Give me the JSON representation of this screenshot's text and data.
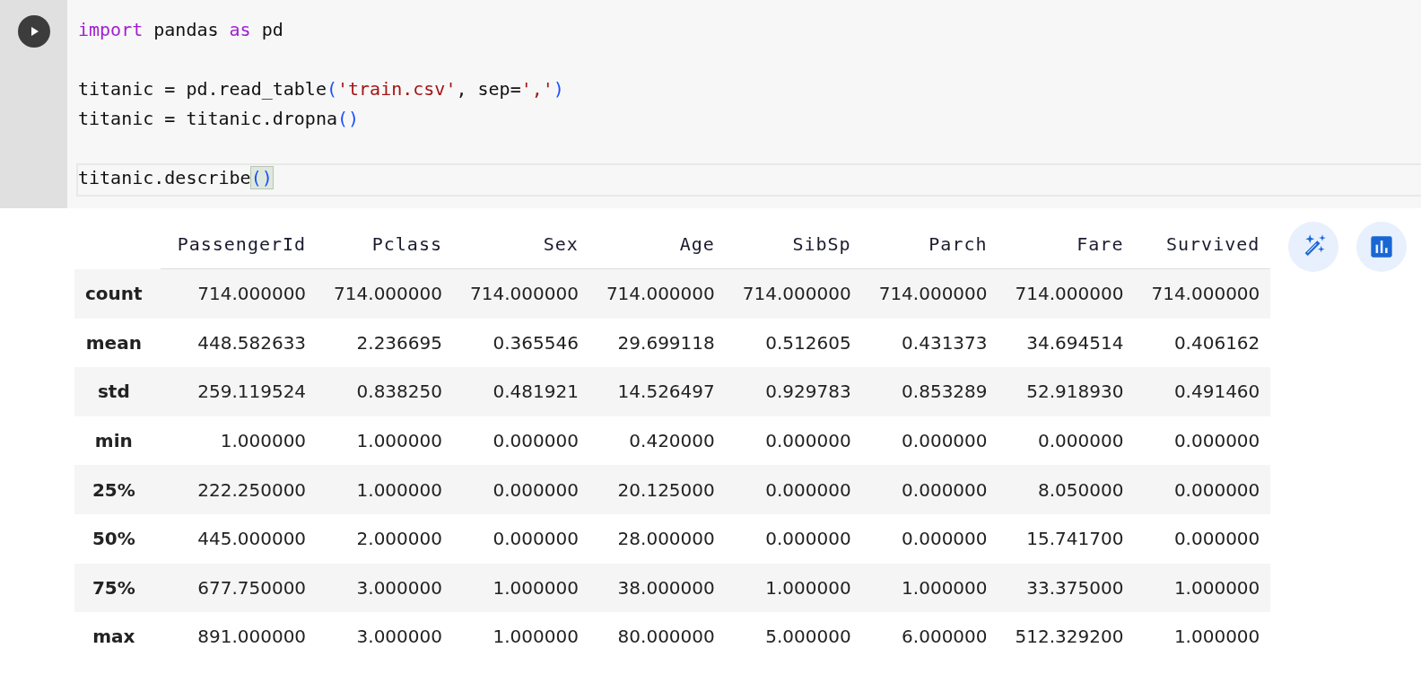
{
  "code_cell": {
    "lines": [
      {
        "kind": "code",
        "current": false,
        "tokens": [
          {
            "kind": "keyword",
            "text": "import"
          },
          {
            "kind": "plain",
            "text": " pandas "
          },
          {
            "kind": "keyword",
            "text": "as"
          },
          {
            "kind": "plain",
            "text": " pd"
          }
        ]
      },
      {
        "kind": "blank"
      },
      {
        "kind": "code",
        "current": false,
        "tokens": [
          {
            "kind": "plain",
            "text": "titanic = pd.read_table"
          },
          {
            "kind": "paren",
            "text": "("
          },
          {
            "kind": "string",
            "text": "'train.csv'"
          },
          {
            "kind": "plain",
            "text": ", sep="
          },
          {
            "kind": "string",
            "text": "','"
          },
          {
            "kind": "paren",
            "text": ")"
          }
        ]
      },
      {
        "kind": "code",
        "current": false,
        "tokens": [
          {
            "kind": "plain",
            "text": "titanic = titanic.dropna"
          },
          {
            "kind": "paren",
            "text": "()"
          }
        ]
      },
      {
        "kind": "blank"
      },
      {
        "kind": "code",
        "current": true,
        "tokens": [
          {
            "kind": "plain",
            "text": "titanic.describe"
          },
          {
            "kind": "matched_paren",
            "text": "()"
          }
        ]
      }
    ]
  },
  "output_table": {
    "columns": [
      "PassengerId",
      "Pclass",
      "Sex",
      "Age",
      "SibSp",
      "Parch",
      "Fare",
      "Survived"
    ],
    "rows": [
      {
        "label": "count",
        "values": [
          "714.000000",
          "714.000000",
          "714.000000",
          "714.000000",
          "714.000000",
          "714.000000",
          "714.000000",
          "714.000000"
        ]
      },
      {
        "label": "mean",
        "values": [
          "448.582633",
          "2.236695",
          "0.365546",
          "29.699118",
          "0.512605",
          "0.431373",
          "34.694514",
          "0.406162"
        ]
      },
      {
        "label": "std",
        "values": [
          "259.119524",
          "0.838250",
          "0.481921",
          "14.526497",
          "0.929783",
          "0.853289",
          "52.918930",
          "0.491460"
        ]
      },
      {
        "label": "min",
        "values": [
          "1.000000",
          "1.000000",
          "0.000000",
          "0.420000",
          "0.000000",
          "0.000000",
          "0.000000",
          "0.000000"
        ]
      },
      {
        "label": "25%",
        "values": [
          "222.250000",
          "1.000000",
          "0.000000",
          "20.125000",
          "0.000000",
          "0.000000",
          "8.050000",
          "0.000000"
        ]
      },
      {
        "label": "50%",
        "values": [
          "445.000000",
          "2.000000",
          "0.000000",
          "28.000000",
          "0.000000",
          "0.000000",
          "15.741700",
          "0.000000"
        ]
      },
      {
        "label": "75%",
        "values": [
          "677.750000",
          "3.000000",
          "1.000000",
          "38.000000",
          "1.000000",
          "1.000000",
          "33.375000",
          "1.000000"
        ]
      },
      {
        "label": "max",
        "values": [
          "891.000000",
          "3.000000",
          "1.000000",
          "80.000000",
          "5.000000",
          "6.000000",
          "512.329200",
          "1.000000"
        ]
      }
    ]
  }
}
